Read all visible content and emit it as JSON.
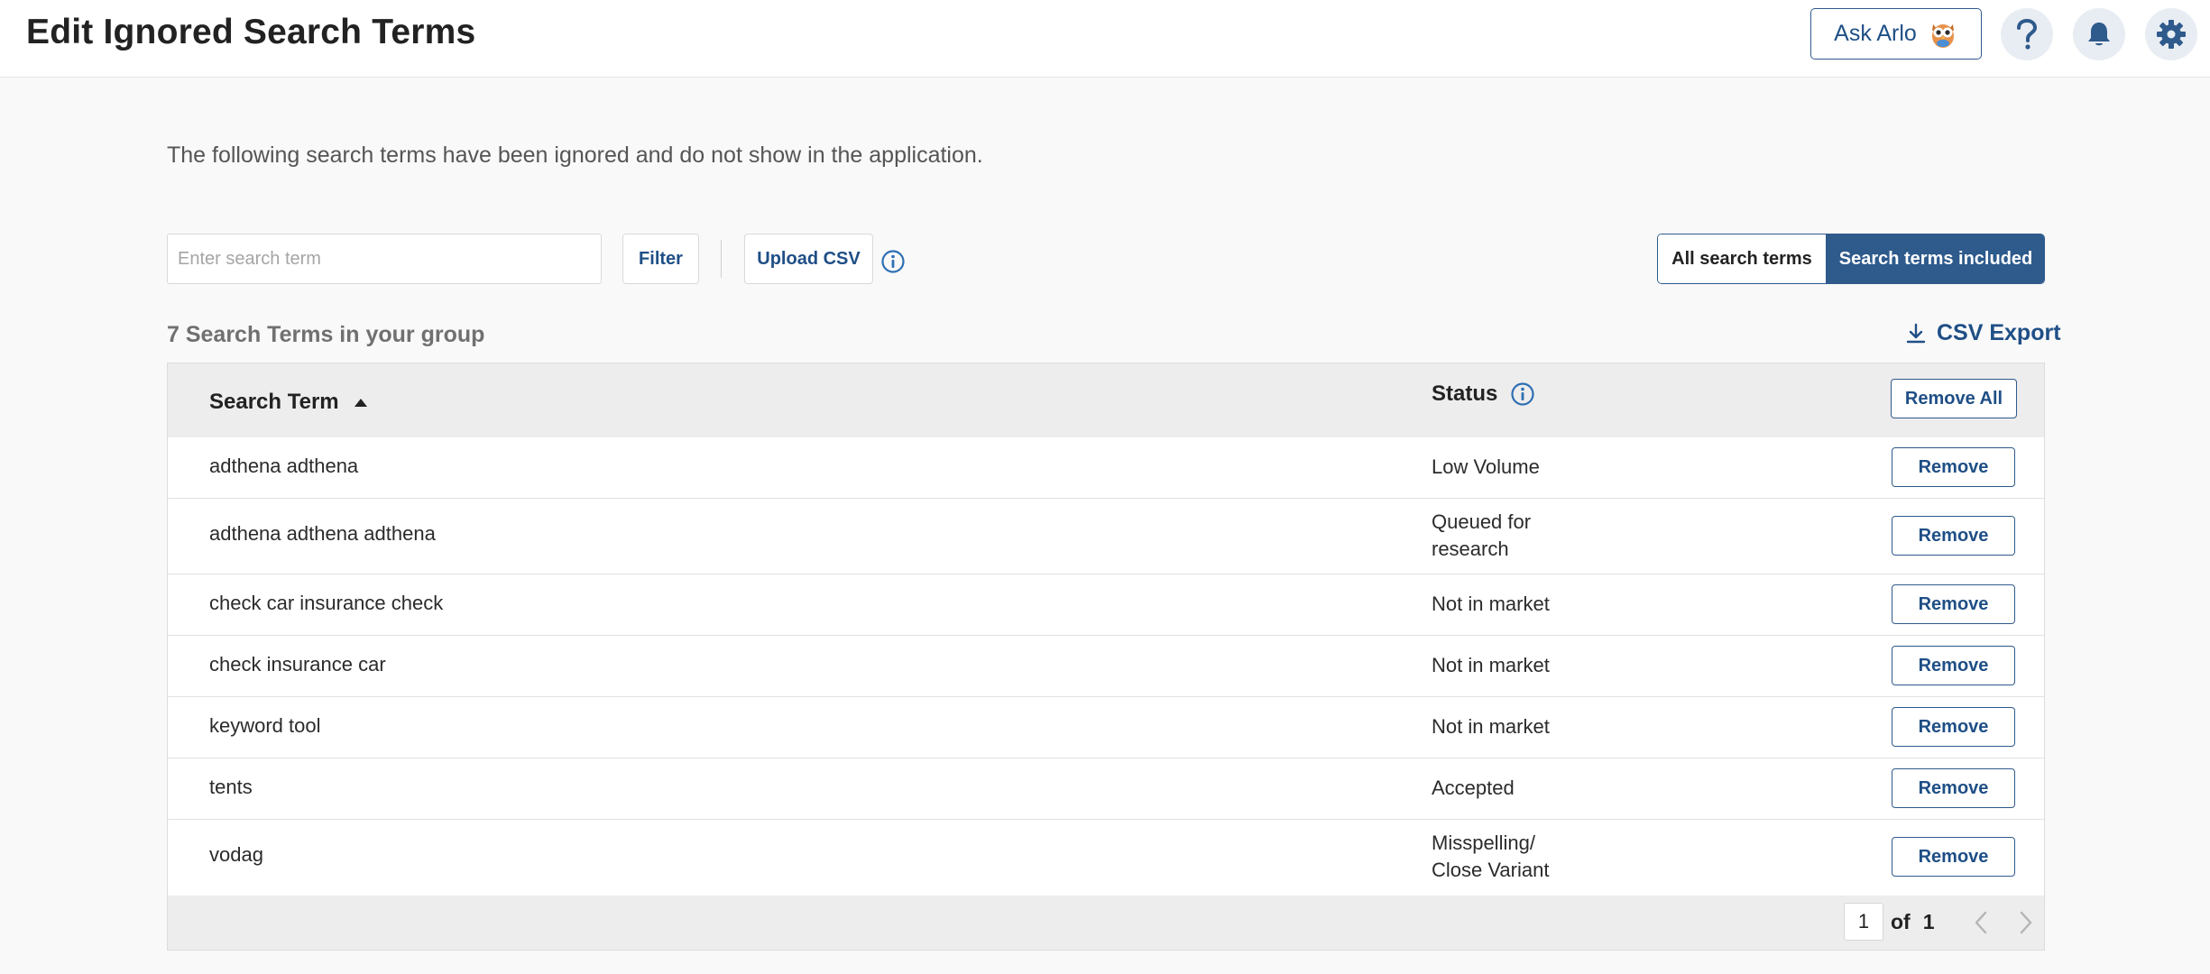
{
  "header": {
    "title": "Edit Ignored Search Terms",
    "ask_label": "Ask Arlo",
    "icons": [
      "help-icon",
      "bell-icon",
      "gear-icon"
    ]
  },
  "description": "The following search terms have been ignored and do not show in the application.",
  "toolbar": {
    "search_placeholder": "Enter search term",
    "search_value": "",
    "filter_label": "Filter",
    "upload_label": "Upload CSV"
  },
  "view_toggle": {
    "options": [
      "All search terms",
      "Search terms included"
    ],
    "selected": "Search terms included"
  },
  "summary": {
    "count_text": "7 Search Terms in your group",
    "export_label": "CSV Export"
  },
  "table": {
    "columns": {
      "term": "Search Term",
      "status": "Status",
      "remove_all": "Remove All"
    },
    "sort": "ascending",
    "remove_label": "Remove",
    "rows": [
      {
        "term": "adthena adthena",
        "status": "Low Volume"
      },
      {
        "term": "adthena adthena adthena",
        "status": "Queued for research"
      },
      {
        "term": "check car insurance check",
        "status": "Not in market"
      },
      {
        "term": "check insurance car",
        "status": "Not in market"
      },
      {
        "term": "keyword tool",
        "status": "Not in market"
      },
      {
        "term": "tents",
        "status": "Accepted"
      },
      {
        "term": "vodag",
        "status": "Misspelling/ Close Variant"
      }
    ]
  },
  "pagination": {
    "current": "1",
    "of_label": "of",
    "total": "1"
  },
  "colors": {
    "accent": "#2e5a8c",
    "link": "#1f4f86",
    "header_bg": "#ededed",
    "page_bg": "#f9f9f9"
  }
}
